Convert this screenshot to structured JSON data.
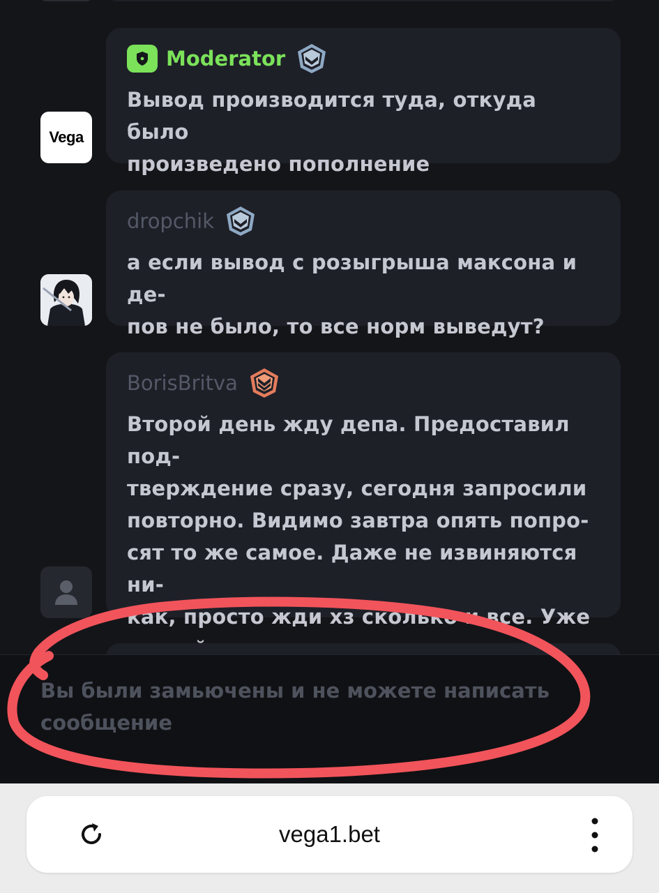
{
  "messages": [
    {
      "author": "Moderator",
      "role": "moderator",
      "avatar": "vega-logo",
      "avatar_text": "Vega",
      "rank_icon": "silver-rank-icon",
      "text": "Вывод производится туда, откуда было\nпроизведено пополнение"
    },
    {
      "author": "dropchik",
      "avatar": "anime-avatar",
      "rank_icon": "silver-rank-icon",
      "text": "а если вывод с розыгрыша максона и де-\nпов не было, то все норм выведут?"
    },
    {
      "author": "BorisBritva",
      "avatar": "default-user-avatar",
      "rank_icon": "bronze-rank-icon",
      "text": "Второй день жду депа. Предоставил под-\nтверждение сразу, сегодня запросили\nповторно. Видимо завтра опять попро-\nсят то же самое. Даже не извиняются ни-\nкак, просто жди хз сколько и все. Уже\nтретий раз такая ситуация"
    }
  ],
  "composer": {
    "muted_text": "Вы были замьючены и не можете написать\nсообщение"
  },
  "browser": {
    "url": "vega1.bet",
    "reload_icon": "reload-icon",
    "menu_icon": "more-vertical-icon"
  },
  "colors": {
    "background": "#141519",
    "bubble": "#1e2028",
    "moderator_green": "#7be25a",
    "annotation_red": "#f2545b"
  }
}
